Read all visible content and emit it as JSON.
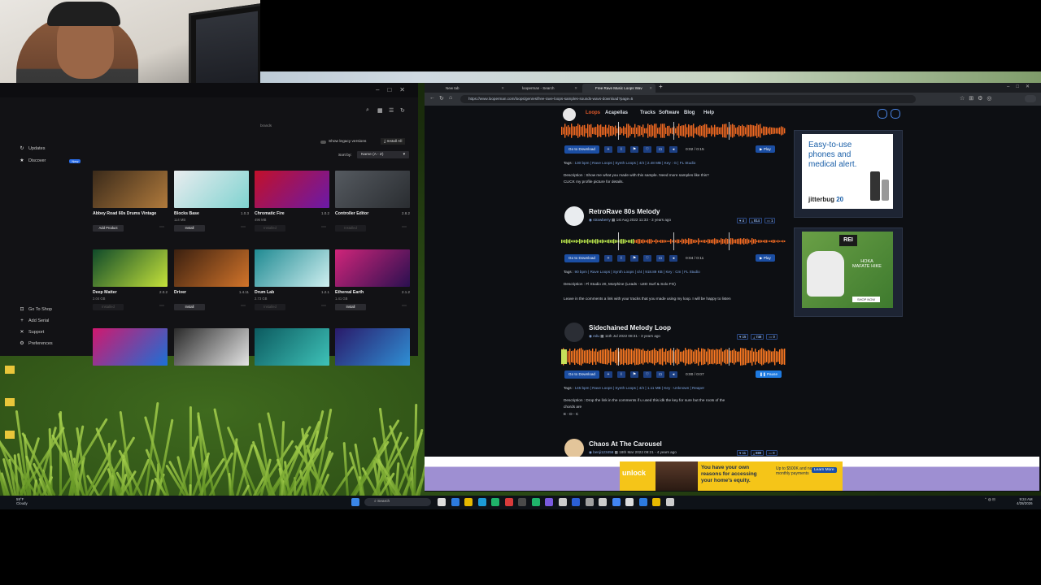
{
  "plugin_manager": {
    "show_legacy": "Show legacy versions",
    "install_all": "Install All",
    "sort_label": "Sort by:",
    "sort_value": "Name (A - Z)",
    "search_hint": "brands",
    "sidebar": [
      {
        "label": "Updates",
        "icon": "refresh-icon"
      },
      {
        "label": "Discover",
        "icon": "star-icon",
        "badge": "New"
      }
    ],
    "sidebar_bottom": [
      {
        "label": "Go To Shop"
      },
      {
        "label": "Add Serial"
      },
      {
        "label": "Support"
      },
      {
        "label": "Preferences"
      }
    ],
    "tiles": [
      {
        "name": "Abbey Road 60s Drums Vintage",
        "version": "",
        "size": "",
        "button": "Add Product",
        "color1": "#3a2a1a",
        "color2": "#b07a3c"
      },
      {
        "name": "Blocks Base",
        "version": "1.0.3",
        "size": "114 MB",
        "button": "Install",
        "color1": "#e9ecef",
        "color2": "#7fd3d0"
      },
      {
        "name": "Chromatic Fire",
        "version": "1.0.2",
        "size": "496 MB",
        "button": "Installed",
        "color1": "#c2102a",
        "color2": "#6a1aa8"
      },
      {
        "name": "Controller Editor",
        "version": "2.8.2",
        "size": "",
        "button": "Installed",
        "color1": "#555a60",
        "color2": "#2a2d31"
      },
      {
        "name": "Deep Matter",
        "version": "2.0.2",
        "size": "2.04 GB",
        "button": "Installed",
        "color1": "#0f4a2a",
        "color2": "#c5e23a"
      },
      {
        "name": "Driver",
        "version": "1.4.11",
        "size": "",
        "button": "Install",
        "color1": "#3b2010",
        "color2": "#d2742a"
      },
      {
        "name": "Drum Lab",
        "version": "1.2.1",
        "size": "2.73 GB",
        "button": "Installed",
        "color1": "#1f8a92",
        "color2": "#cfeff0"
      },
      {
        "name": "Ethereal Earth",
        "version": "2.1.2",
        "size": "1.41 GB",
        "button": "Install",
        "color1": "#d0257a",
        "color2": "#2a1050"
      },
      {
        "name": "",
        "version": "",
        "size": "",
        "button": "",
        "color1": "#d0186e",
        "color2": "#1c70d6"
      },
      {
        "name": "",
        "version": "",
        "size": "",
        "button": "",
        "color1": "#2a2a2a",
        "color2": "#e4e4e4"
      },
      {
        "name": "",
        "version": "",
        "size": "",
        "button": "",
        "color1": "#0c5a5f",
        "color2": "#3ec2b8"
      },
      {
        "name": "",
        "version": "",
        "size": "",
        "button": "",
        "color1": "#2a1a6a",
        "color2": "#2f8fd4"
      }
    ]
  },
  "browser": {
    "tabs": [
      {
        "label": "New tab"
      },
      {
        "label": "looperman - Search"
      },
      {
        "label": "Free Rave Music Loops Wav",
        "active": true
      }
    ],
    "url": "https://www.looperman.com/loops/genres/free-rave-loops-samples-sounds-wavs-download?page=5",
    "nav": [
      "Loops",
      "Acapellas",
      "Tracks",
      "Software",
      "Blog",
      "Help"
    ],
    "loops": [
      {
        "title": "",
        "time": "0:02 / 0:15",
        "play": "Play",
        "tags": "130 bpm | Rave Loops | Synth Loops | 4/4 | 2.48 MB | Key : G | FL Studio",
        "desc1": "Description : Show me what you made with this sample. Need more samples like this?",
        "desc2": "CLICK my profile picture for details."
      },
      {
        "title": "RetroRave 80s Melody",
        "author": "strawberry",
        "date": "1st Aug 2022 11:33",
        "ago": "- 3 years ago",
        "stats": [
          "4",
          "814",
          "1"
        ],
        "time": "0:04 / 0:11",
        "play": "Play",
        "tags": "90 bpm | Rave Loops | Synth Loops | 4/4 | 918.89 KB | Key : Cm | FL Studio",
        "desc1": "Description : Fl Studio 20, Morphine (Leads - LED Surf & Solo FG)",
        "desc2": "Leave in the comments a link with your tracks that you made using my loop. I will be happy to listen"
      },
      {
        "title": "Sidechained Melody Loop",
        "author": "edu",
        "date": "11th Jul 2022 08:31",
        "ago": "- 3 years ago",
        "stats": [
          "15",
          "746",
          "0"
        ],
        "time": "0:00 / 0:07",
        "play": "Pause",
        "tags": "145 bpm | Rave Loops | Synth Loops | 4/4 | 1.11 MB | Key : Unknown | Reaper",
        "desc1": "Description : Drop the link in the comments if u used this idk the key for sure but the roots of the",
        "desc2": "chords are",
        "desc3": "E - D - C"
      },
      {
        "title": "Chaos At The Carousel",
        "author": "benji123456",
        "date": "18th Mar 2022 09:21",
        "ago": "- 4 years ago",
        "stats": [
          "11",
          "889",
          "0"
        ]
      }
    ],
    "download_label": "Go to Download",
    "ads": {
      "jitterbug_line1": "Easy-to-use",
      "jitterbug_line2": "phones and",
      "jitterbug_line3": "medical alert.",
      "jitterbug_brand": "jitterbug",
      "jitterbug_model": "20",
      "rei_brand": "REI",
      "rei_text1": "HOKA",
      "rei_text2": "MAFATE HIKE",
      "rei_cta": "SHOP NOW"
    },
    "bottom_ad": {
      "brand": "unlock",
      "line1": "You have your own",
      "line2": "reasons for accessing",
      "line3": "your home's equity.",
      "line4": "Up to $500K and no",
      "line5": "monthly payments",
      "cta": "Learn More"
    }
  },
  "taskbar": {
    "weather_temp": "59°F",
    "weather_desc": "Cloudy",
    "search": "Search",
    "time": "9:24 AM",
    "date": "4/28/2026"
  }
}
